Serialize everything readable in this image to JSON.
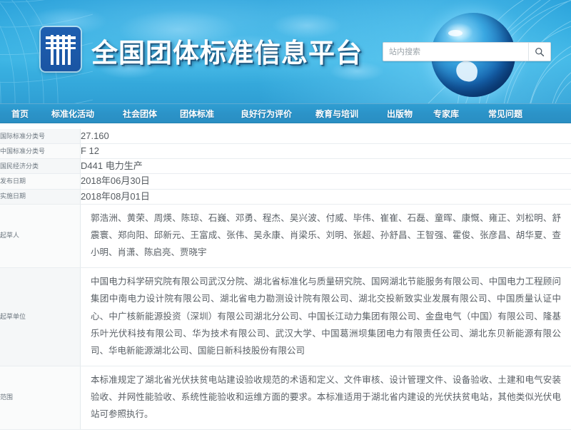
{
  "header": {
    "site_title": "全国团体标准信息平台",
    "logo_name": "platform-logo",
    "search": {
      "placeholder": "站内搜索",
      "value": "",
      "button_icon": "search-icon"
    }
  },
  "nav": {
    "items": [
      {
        "label": "首页"
      },
      {
        "label": "标准化活动"
      },
      {
        "label": "社会团体"
      },
      {
        "label": "团体标准"
      },
      {
        "label": "良好行为评价"
      },
      {
        "label": "教育与培训"
      },
      {
        "label": "出版物"
      },
      {
        "label": "专家库"
      },
      {
        "label": "常见问题"
      }
    ]
  },
  "detail": {
    "rows": [
      {
        "label": "国际标准分类号",
        "value": "27.160"
      },
      {
        "label": "中国标准分类号",
        "value": "F 12"
      },
      {
        "label": "国民经济分类",
        "value": "D441 电力生产"
      },
      {
        "label": "发布日期",
        "value": "2018年06月30日"
      },
      {
        "label": "实施日期",
        "value": "2018年08月01日"
      },
      {
        "label": "起草人",
        "value": "郭浩洲、黄荣、周煐、陈琼、石巍、邓勇、程杰、吴兴波、付威、毕伟、崔崔、石磊、童晖、康慨、雍正、刘松明、舒震寰、郑向阳、邱新元、王富成、张伟、吴永康、肖梁乐、刘明、张超、孙舒昌、王智强、霍俊、张彦昌、胡华夏、查小明、肖潇、陈启亮、贾晓宇"
      },
      {
        "label": "起草单位",
        "value": "中国电力科学研究院有限公司武汉分院、湖北省标准化与质量研究院、国网湖北节能服务有限公司、中国电力工程顾问集团中南电力设计院有限公司、湖北省电力勘测设计院有限公司、湖北交投新致实业发展有限公司、中国质量认证中心、中广核新能源投资（深圳）有限公司湖北分公司、中国长江动力集团有限公司、金盘电气（中国）有限公司、隆基乐叶光伏科技有限公司、华为技术有限公司、武汉大学、中国葛洲坝集团电力有限责任公司、湖北东贝新能源有限公司、华电新能源湖北公司、国能日新科技股份有限公司"
      },
      {
        "label": "范围",
        "value": "本标准规定了湖北省光伏扶贫电站建设验收规范的术语和定义、文件审核、设计管理文件、设备验收、土建和电气安装验收、并网性能验收、系统性能验收和运维方面的要求。本标准适用于湖北省内建设的光伏扶贫电站，其他类似光伏电站可参照执行。"
      }
    ]
  },
  "colors": {
    "banner_blue": "#2aa7dd",
    "nav_blue": "#2b93c8",
    "logo_blue": "#1a55a3",
    "label_bg": "#f5f7f8",
    "text_gray": "#555b60"
  }
}
